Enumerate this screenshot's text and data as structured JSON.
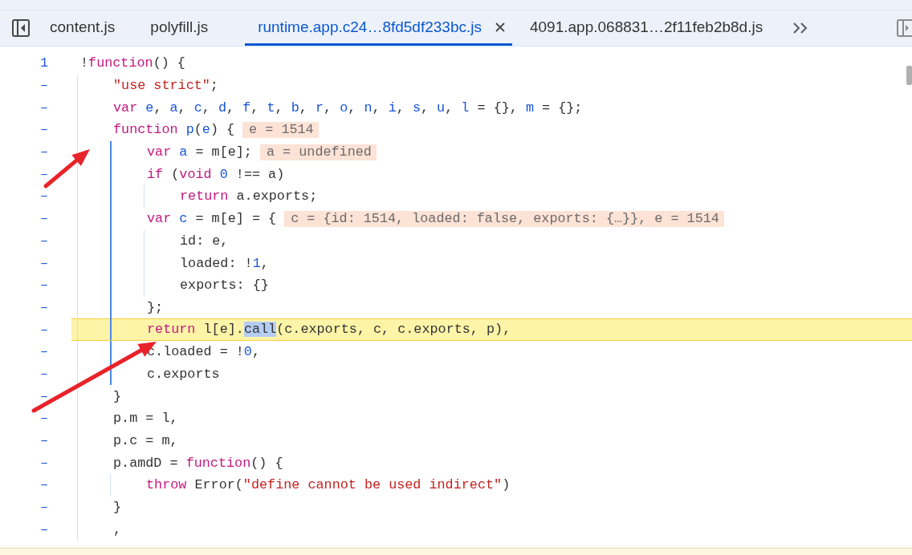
{
  "tabs": [
    {
      "label": "content.js",
      "selected": false,
      "closable": false
    },
    {
      "label": "polyfill.js",
      "selected": false,
      "closable": false
    },
    {
      "label": "runtime.app.c24…8fd5df233bc.js",
      "selected": true,
      "closable": true
    },
    {
      "label": "4091.app.068831…2f11feb2b8d.js",
      "selected": false,
      "closable": false
    }
  ],
  "editor": {
    "lines": [
      {
        "gutter": "1",
        "highlighted": false,
        "tokens": [
          {
            "kind": "plain",
            "text": "!"
          },
          {
            "kind": "kw",
            "text": "function"
          },
          {
            "kind": "plain",
            "text": "() {"
          }
        ],
        "children": [
          {
            "gutter": "–",
            "highlighted": false,
            "tokens": [
              {
                "kind": "str",
                "text": "\"use strict\""
              },
              {
                "kind": "plain",
                "text": ";"
              }
            ]
          },
          {
            "gutter": "–",
            "highlighted": false,
            "tokens": [
              {
                "kind": "kw",
                "text": "var"
              },
              {
                "kind": "def",
                "text": " e"
              },
              {
                "kind": "plain",
                "text": ", "
              },
              {
                "kind": "def",
                "text": "a"
              },
              {
                "kind": "plain",
                "text": ", "
              },
              {
                "kind": "def",
                "text": "c"
              },
              {
                "kind": "plain",
                "text": ", "
              },
              {
                "kind": "def",
                "text": "d"
              },
              {
                "kind": "plain",
                "text": ", "
              },
              {
                "kind": "def",
                "text": "f"
              },
              {
                "kind": "plain",
                "text": ", "
              },
              {
                "kind": "def",
                "text": "t"
              },
              {
                "kind": "plain",
                "text": ", "
              },
              {
                "kind": "def",
                "text": "b"
              },
              {
                "kind": "plain",
                "text": ", "
              },
              {
                "kind": "def",
                "text": "r"
              },
              {
                "kind": "plain",
                "text": ", "
              },
              {
                "kind": "def",
                "text": "o"
              },
              {
                "kind": "plain",
                "text": ", "
              },
              {
                "kind": "def",
                "text": "n"
              },
              {
                "kind": "plain",
                "text": ", "
              },
              {
                "kind": "def",
                "text": "i"
              },
              {
                "kind": "plain",
                "text": ", "
              },
              {
                "kind": "def",
                "text": "s"
              },
              {
                "kind": "plain",
                "text": ", "
              },
              {
                "kind": "def",
                "text": "u"
              },
              {
                "kind": "plain",
                "text": ", "
              },
              {
                "kind": "def",
                "text": "l"
              },
              {
                "kind": "plain",
                "text": " = {}, "
              },
              {
                "kind": "def",
                "text": "m"
              },
              {
                "kind": "plain",
                "text": " = {};"
              }
            ]
          },
          {
            "gutter": "–",
            "highlighted": false,
            "tokens": [
              {
                "kind": "kw",
                "text": "function"
              },
              {
                "kind": "def",
                "text": " p"
              },
              {
                "kind": "plain",
                "text": "("
              },
              {
                "kind": "def",
                "text": "e"
              },
              {
                "kind": "plain",
                "text": ") {"
              }
            ],
            "inline_value": "e = 1514",
            "children": [
              {
                "gutter": "–",
                "highlighted": false,
                "tokens": [
                  {
                    "kind": "kw",
                    "text": "var"
                  },
                  {
                    "kind": "def",
                    "text": " a"
                  },
                  {
                    "kind": "plain",
                    "text": " = m[e];"
                  }
                ],
                "inline_value": "a = undefined"
              },
              {
                "gutter": "–",
                "highlighted": false,
                "tokens": [
                  {
                    "kind": "kw",
                    "text": "if"
                  },
                  {
                    "kind": "plain",
                    "text": " ("
                  },
                  {
                    "kind": "kw",
                    "text": "void"
                  },
                  {
                    "kind": "num",
                    "text": " 0"
                  },
                  {
                    "kind": "plain",
                    "text": " !== a)"
                  }
                ],
                "children": [
                  {
                    "gutter": "–",
                    "highlighted": false,
                    "tokens": [
                      {
                        "kind": "kw",
                        "text": "return"
                      },
                      {
                        "kind": "plain",
                        "text": " a.exports;"
                      }
                    ]
                  }
                ]
              },
              {
                "gutter": "–",
                "highlighted": false,
                "tokens": [
                  {
                    "kind": "kw",
                    "text": "var"
                  },
                  {
                    "kind": "def",
                    "text": " c"
                  },
                  {
                    "kind": "plain",
                    "text": " = m[e] = {"
                  }
                ],
                "inline_value": "c = {id: 1514, loaded: false, exports: {…}}, e = 1514",
                "children": [
                  {
                    "gutter": "–",
                    "highlighted": false,
                    "tokens": [
                      {
                        "kind": "plain",
                        "text": "id: e,"
                      }
                    ]
                  },
                  {
                    "gutter": "–",
                    "highlighted": false,
                    "tokens": [
                      {
                        "kind": "plain",
                        "text": "loaded: !"
                      },
                      {
                        "kind": "num",
                        "text": "1"
                      },
                      {
                        "kind": "plain",
                        "text": ","
                      }
                    ]
                  },
                  {
                    "gutter": "–",
                    "highlighted": false,
                    "tokens": [
                      {
                        "kind": "plain",
                        "text": "exports: {}"
                      }
                    ]
                  }
                ]
              },
              {
                "gutter": "–",
                "highlighted": false,
                "tokens": [
                  {
                    "kind": "plain",
                    "text": "};"
                  }
                ]
              },
              {
                "gutter": "–",
                "highlighted": true,
                "tokens": [
                  {
                    "kind": "kw",
                    "text": "return"
                  },
                  {
                    "kind": "plain",
                    "text": " l[e]."
                  },
                  {
                    "kind": "sel",
                    "text": "call"
                  },
                  {
                    "kind": "plain",
                    "text": "(c.exports, c, c.exports, p),"
                  }
                ]
              },
              {
                "gutter": "–",
                "highlighted": false,
                "tokens": [
                  {
                    "kind": "plain",
                    "text": "c.loaded = !"
                  },
                  {
                    "kind": "num",
                    "text": "0"
                  },
                  {
                    "kind": "plain",
                    "text": ","
                  }
                ]
              },
              {
                "gutter": "–",
                "highlighted": false,
                "tokens": [
                  {
                    "kind": "plain",
                    "text": "c.exports"
                  }
                ]
              }
            ]
          },
          {
            "gutter": "–",
            "highlighted": false,
            "tokens": [
              {
                "kind": "plain",
                "text": "}"
              }
            ]
          },
          {
            "gutter": "–",
            "highlighted": false,
            "tokens": [
              {
                "kind": "plain",
                "text": "p.m = l,"
              }
            ]
          },
          {
            "gutter": "–",
            "highlighted": false,
            "tokens": [
              {
                "kind": "plain",
                "text": "p.c = m,"
              }
            ]
          },
          {
            "gutter": "–",
            "highlighted": false,
            "tokens": [
              {
                "kind": "plain",
                "text": "p.amdD = "
              },
              {
                "kind": "kw",
                "text": "function"
              },
              {
                "kind": "plain",
                "text": "() {"
              }
            ],
            "children": [
              {
                "gutter": "–",
                "highlighted": false,
                "tokens": [
                  {
                    "kind": "kw",
                    "text": "throw"
                  },
                  {
                    "kind": "plain",
                    "text": " Error("
                  },
                  {
                    "kind": "str",
                    "text": "\"define cannot be used indirect\""
                  },
                  {
                    "kind": "plain",
                    "text": ")"
                  }
                ]
              }
            ]
          },
          {
            "gutter": "–",
            "highlighted": false,
            "tokens": [
              {
                "kind": "plain",
                "text": "}"
              }
            ]
          },
          {
            "gutter": "–",
            "highlighted": false,
            "tokens": [
              {
                "kind": "plain",
                "text": ","
              }
            ]
          }
        ]
      }
    ]
  },
  "annotations": [
    {
      "kind": "arrow"
    },
    {
      "kind": "arrow"
    }
  ]
}
